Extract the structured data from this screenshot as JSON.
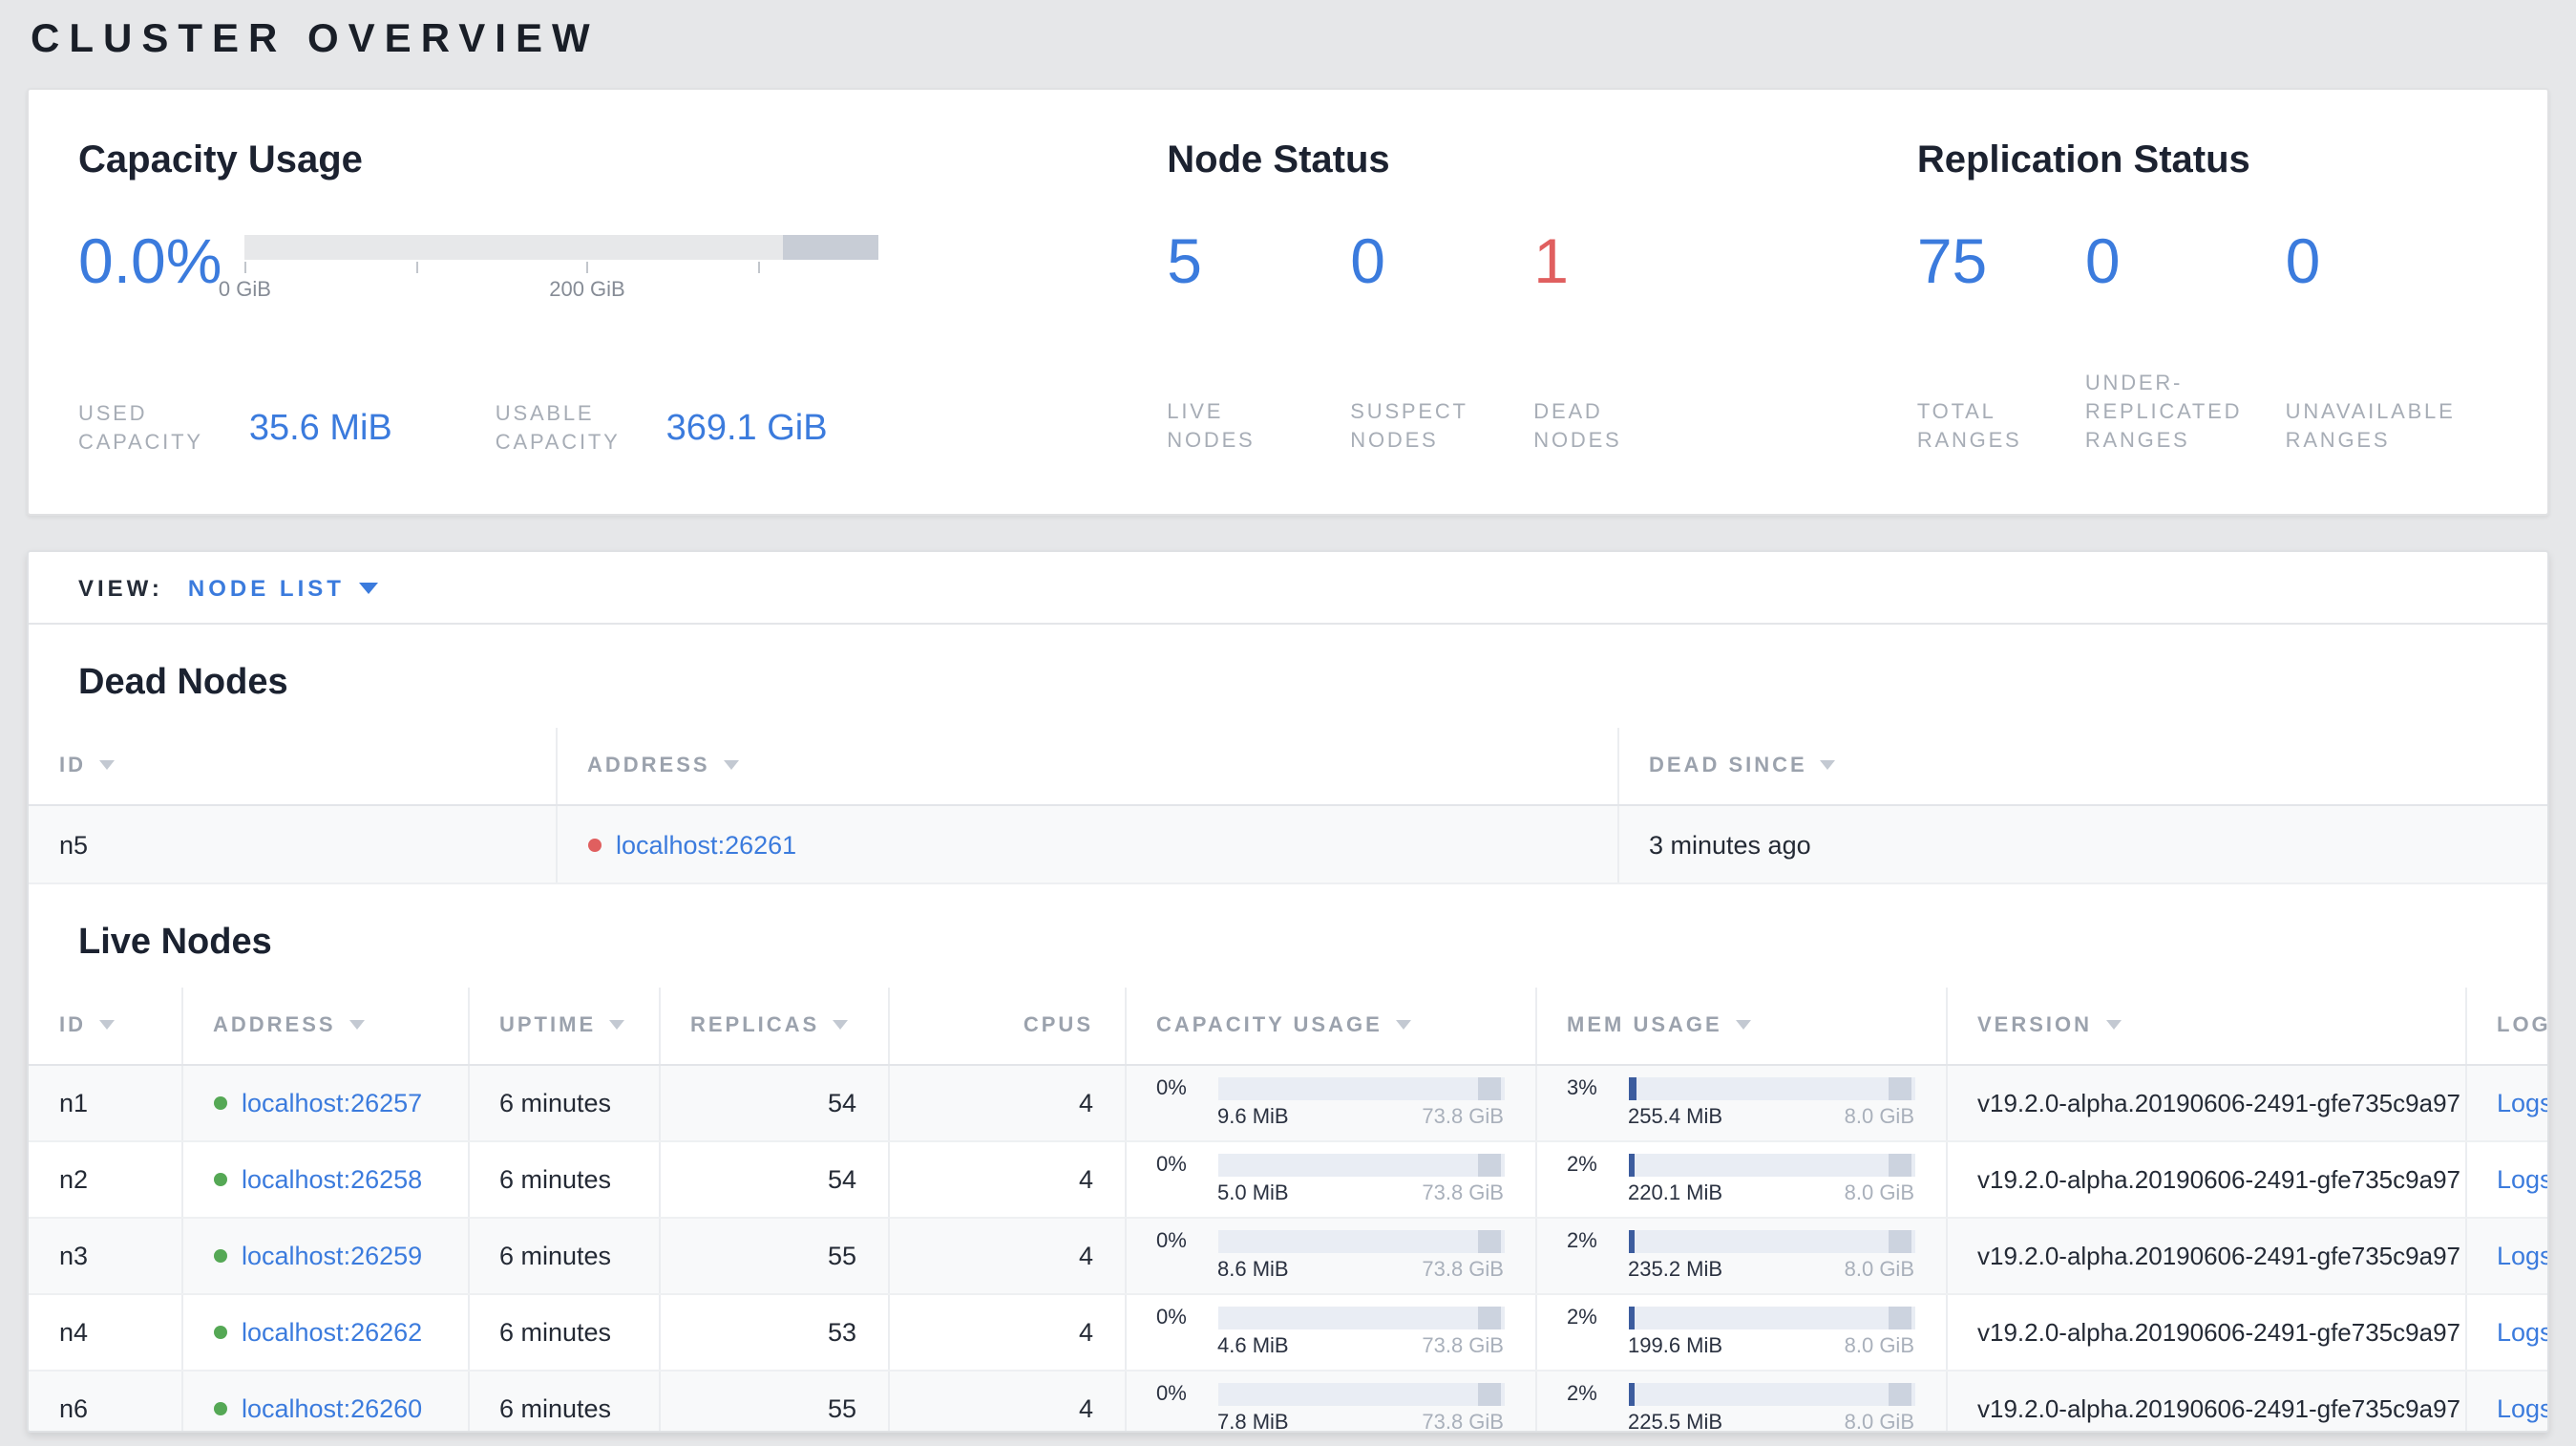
{
  "page_title": "CLUSTER OVERVIEW",
  "colors": {
    "accent_blue": "#3b7bdd",
    "danger_red": "#e05f5f",
    "healthy_green": "#55a855"
  },
  "summary": {
    "capacity": {
      "title": "Capacity Usage",
      "percent": "0.0%",
      "tick_labels": [
        "0 GiB",
        "200 GiB"
      ],
      "used_label": "USED\nCAPACITY",
      "used_value": "35.6 MiB",
      "usable_label": "USABLE\nCAPACITY",
      "usable_value": "369.1 GiB",
      "used_fill": "0%"
    },
    "node_status": {
      "title": "Node Status",
      "live": {
        "value": "5",
        "label": "LIVE\nNODES"
      },
      "suspect": {
        "value": "0",
        "label": "SUSPECT\nNODES"
      },
      "dead": {
        "value": "1",
        "label": "DEAD\nNODES"
      }
    },
    "replication_status": {
      "title": "Replication Status",
      "total": {
        "value": "75",
        "label": "TOTAL\nRANGES"
      },
      "under_replicated": {
        "value": "0",
        "label": "UNDER-\nREPLICATED\nRANGES"
      },
      "unavailable": {
        "value": "0",
        "label": "UNAVAILABLE\nRANGES"
      }
    }
  },
  "view_bar": {
    "label": "VIEW:",
    "selected": "NODE LIST"
  },
  "dead_nodes": {
    "title": "Dead Nodes",
    "headers": {
      "id": "ID",
      "address": "ADDRESS",
      "dead_since": "DEAD SINCE"
    },
    "rows": [
      {
        "id": "n5",
        "address": "localhost:26261",
        "dead_since": "3 minutes ago"
      }
    ]
  },
  "live_nodes": {
    "title": "Live Nodes",
    "headers": {
      "id": "ID",
      "address": "ADDRESS",
      "uptime": "UPTIME",
      "replicas": "REPLICAS",
      "cpus": "CPUS",
      "capacity": "CAPACITY USAGE",
      "memory": "MEM USAGE",
      "version": "VERSION",
      "logs": "LOGS"
    },
    "rows": [
      {
        "id": "n1",
        "address": "localhost:26257",
        "uptime": "6 minutes",
        "replicas": "54",
        "cpus": "4",
        "capacity_pct": "0%",
        "capacity_fill": "0%",
        "capacity_used": "9.6 MiB",
        "capacity_total": "73.8 GiB",
        "mem_pct": "3%",
        "mem_fill": "3%",
        "mem_used": "255.4 MiB",
        "mem_total": "8.0 GiB",
        "version": "v19.2.0-alpha.20190606-2491-gfe735c9a97",
        "logs": "Logs"
      },
      {
        "id": "n2",
        "address": "localhost:26258",
        "uptime": "6 minutes",
        "replicas": "54",
        "cpus": "4",
        "capacity_pct": "0%",
        "capacity_fill": "0%",
        "capacity_used": "5.0 MiB",
        "capacity_total": "73.8 GiB",
        "mem_pct": "2%",
        "mem_fill": "2%",
        "mem_used": "220.1 MiB",
        "mem_total": "8.0 GiB",
        "version": "v19.2.0-alpha.20190606-2491-gfe735c9a97",
        "logs": "Logs"
      },
      {
        "id": "n3",
        "address": "localhost:26259",
        "uptime": "6 minutes",
        "replicas": "55",
        "cpus": "4",
        "capacity_pct": "0%",
        "capacity_fill": "0%",
        "capacity_used": "8.6 MiB",
        "capacity_total": "73.8 GiB",
        "mem_pct": "2%",
        "mem_fill": "2%",
        "mem_used": "235.2 MiB",
        "mem_total": "8.0 GiB",
        "version": "v19.2.0-alpha.20190606-2491-gfe735c9a97",
        "logs": "Logs"
      },
      {
        "id": "n4",
        "address": "localhost:26262",
        "uptime": "6 minutes",
        "replicas": "53",
        "cpus": "4",
        "capacity_pct": "0%",
        "capacity_fill": "0%",
        "capacity_used": "4.6 MiB",
        "capacity_total": "73.8 GiB",
        "mem_pct": "2%",
        "mem_fill": "2%",
        "mem_used": "199.6 MiB",
        "mem_total": "8.0 GiB",
        "version": "v19.2.0-alpha.20190606-2491-gfe735c9a97",
        "logs": "Logs"
      },
      {
        "id": "n6",
        "address": "localhost:26260",
        "uptime": "6 minutes",
        "replicas": "55",
        "cpus": "4",
        "capacity_pct": "0%",
        "capacity_fill": "0%",
        "capacity_used": "7.8 MiB",
        "capacity_total": "73.8 GiB",
        "mem_pct": "2%",
        "mem_fill": "2%",
        "mem_used": "225.5 MiB",
        "mem_total": "8.0 GiB",
        "version": "v19.2.0-alpha.20190606-2491-gfe735c9a97",
        "logs": "Logs"
      }
    ]
  }
}
